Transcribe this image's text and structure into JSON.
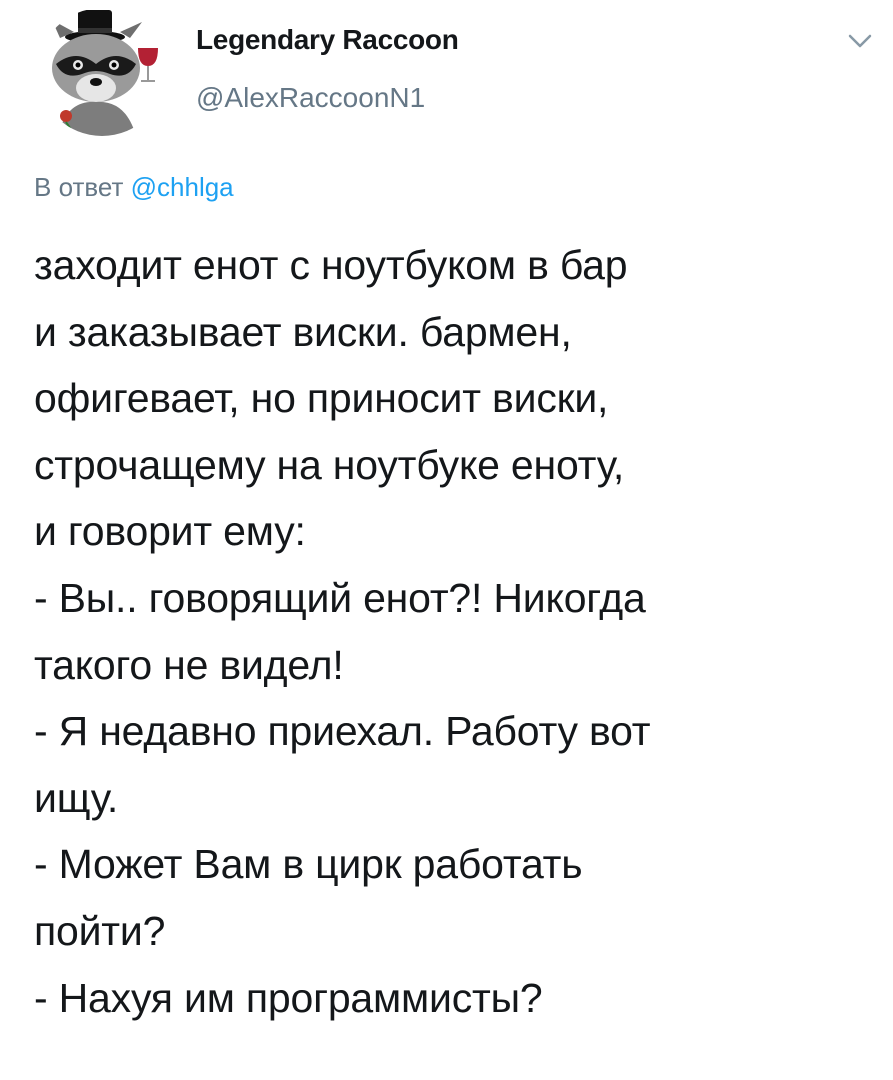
{
  "author": {
    "display_name": "Legendary Raccoon",
    "handle": "@AlexRaccoonN1",
    "avatar_icon": "raccoon-top-hat-avatar-icon"
  },
  "menu": {
    "caret_icon": "chevron-down-icon"
  },
  "reply": {
    "prefix": "В ответ",
    "mention": "@chhlga"
  },
  "tweet": {
    "lines": [
      "заходит енот с ноутбуком в бар",
      "и заказывает виски. бармен,",
      "офигевает, но приносит виски,",
      "строчащему на ноутбуке еноту,",
      "и говорит ему:",
      "- Вы.. говорящий енот?! Никогда",
      "такого не видел!",
      "- Я недавно приехал. Работу вот",
      "ищу.",
      "- Может Вам в цирк работать",
      "пойти?",
      "- Нахуя им программисты?"
    ]
  },
  "colors": {
    "text": "#14171a",
    "secondary": "#657786",
    "link": "#1da1f2"
  }
}
